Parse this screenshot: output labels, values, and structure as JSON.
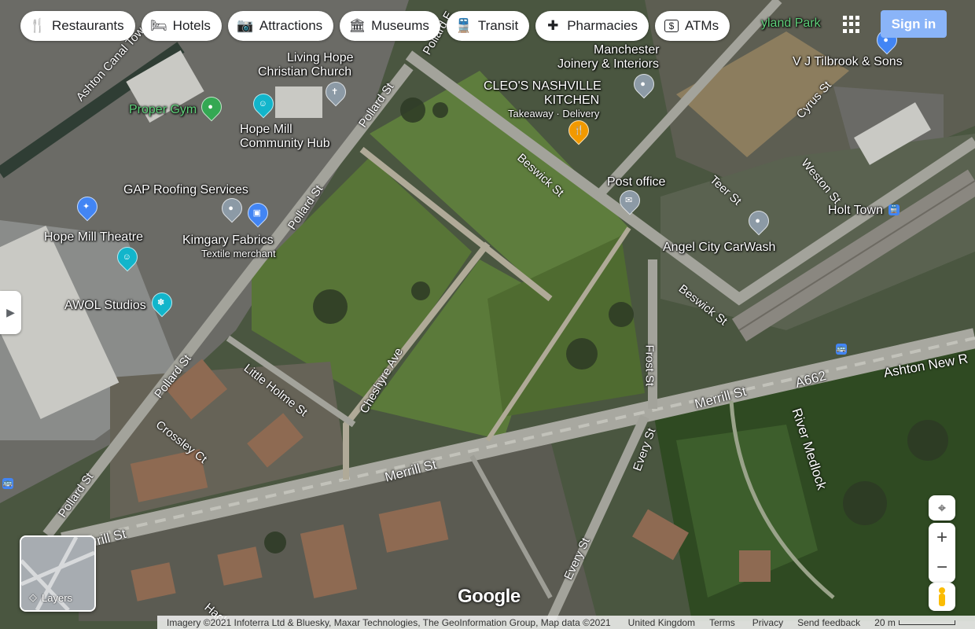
{
  "categories": [
    {
      "label": "Restaurants",
      "icon": "fork-knife-icon",
      "glyph": "🍴"
    },
    {
      "label": "Hotels",
      "icon": "bed-icon",
      "glyph": "🛏"
    },
    {
      "label": "Attractions",
      "icon": "camera-icon",
      "glyph": "📷"
    },
    {
      "label": "Museums",
      "icon": "museum-icon",
      "glyph": "🏛"
    },
    {
      "label": "Transit",
      "icon": "bus-icon",
      "glyph": "🚆"
    },
    {
      "label": "Pharmacies",
      "icon": "pharmacy-icon",
      "glyph": "✚"
    },
    {
      "label": "ATMs",
      "icon": "atm-icon",
      "glyph": "$"
    }
  ],
  "header": {
    "sign_in": "Sign in"
  },
  "places": {
    "living_hope_1": "Living Hope",
    "living_hope_2": "Christian Church",
    "manchester_1": "Manchester",
    "manchester_2": "Joinery & Interiors",
    "cleos_1": "CLEO'S NASHVILLE",
    "cleos_2": "KITCHEN",
    "cleos_sub": "Takeaway · Delivery",
    "proper_gym": "Proper Gym",
    "hope_mill_hub_1": "Hope Mill",
    "hope_mill_hub_2": "Community Hub",
    "gap_roofing": "GAP Roofing Services",
    "hope_mill_theatre": "Hope Mill Theatre",
    "kimgary": "Kimgary Fabrics",
    "kimgary_sub": "Textile merchant",
    "awol": "AWOL Studios",
    "post_office": "Post office",
    "angel_city": "Angel City CarWash",
    "holt_town": "Holt Town",
    "vj_tilbrook": "V J Tilbrook & Sons",
    "park_partial": "yland Park"
  },
  "streets": {
    "ashton_canal": "Ashton Canal Tow",
    "pollard_1": "Pollard St",
    "pollard_2": "Pollard St",
    "pollard_3": "Pollard St",
    "pollard_4": "Pollard St",
    "beswick_1": "Beswick St",
    "beswick_2": "Beswick St",
    "teer": "Teer St",
    "weston": "Weston St",
    "cyrus": "Cyrus St",
    "frost": "Frost St",
    "little_holme": "Little Holme St",
    "cheshyre": "Cheshyre Ave",
    "crossley": "Crossley Ct",
    "merrill_1": "Merrill St",
    "merrill_2": "Merrill St",
    "merrill_3": "rrill St",
    "every_1": "Every St",
    "every_2": "Every St",
    "a662": "A662",
    "ashton_new": "Ashton New R",
    "river_medlock": "River Medlock",
    "hack": "Hack",
    "top_partial": "Pollard E"
  },
  "controls": {
    "layers": "Layers"
  },
  "footer": {
    "imagery": "Imagery ©2021 Infoterra Ltd & Bluesky, Maxar Technologies, The GeoInformation Group, Map data ©2021",
    "region": "United Kingdom",
    "terms": "Terms",
    "privacy": "Privacy",
    "feedback": "Send feedback",
    "scale": "20 m"
  },
  "branding": {
    "logo": "Google"
  },
  "colors": {
    "sign_in_bg": "#8ab4f8",
    "pin_blue": "#4285f4",
    "pin_green": "#34a853",
    "pin_teal": "#12b5cb",
    "pin_gray": "#8c9aa6",
    "pin_orange": "#f29900"
  }
}
